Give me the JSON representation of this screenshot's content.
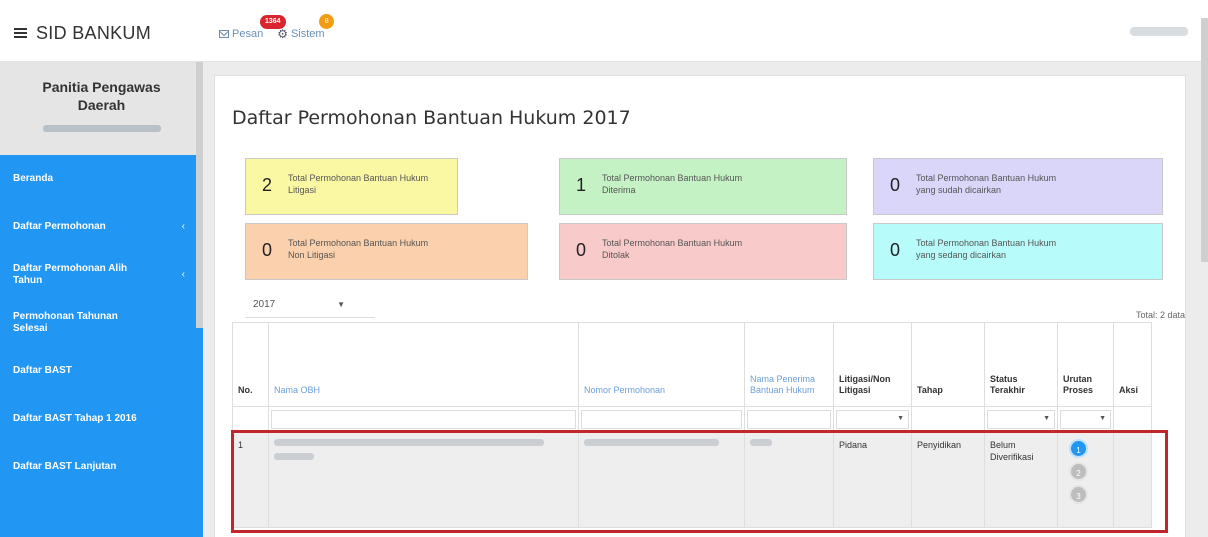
{
  "app": {
    "title": "SID BANKUM"
  },
  "topnav": {
    "pesan_label": "Pesan",
    "pesan_badge": "1364",
    "sistem_label": "Sistem",
    "sistem_badge": "8"
  },
  "sidebar": {
    "org_line1": "Panitia Pengawas",
    "org_line2": "Daerah",
    "items": [
      {
        "label": "Beranda",
        "arrow": ""
      },
      {
        "label": "Daftar Permohonan",
        "arrow": "‹"
      },
      {
        "label": "Daftar Permohonan Alih Tahun",
        "arrow": "‹"
      },
      {
        "label": "Permohonan Tahunan Selesai",
        "arrow": ""
      },
      {
        "label": "Daftar BAST",
        "arrow": ""
      },
      {
        "label": "Daftar BAST Tahap 1 2016",
        "arrow": ""
      },
      {
        "label": "Daftar BAST Lanjutan",
        "arrow": ""
      }
    ]
  },
  "main": {
    "title": "Daftar Permohonan Bantuan Hukum 2017",
    "stats": [
      {
        "value": "2",
        "label": "Total Permohonan Bantuan Hukum Litigasi",
        "color": "#fbf8a4"
      },
      {
        "value": "1",
        "label": "Total Permohonan Bantuan Hukum Diterima",
        "color": "#c5f2c5"
      },
      {
        "value": "0",
        "label": "Total Permohonan Bantuan Hukum yang sudah dicairkan",
        "color": "#d9d6fa"
      },
      {
        "value": "0",
        "label": "Total Permohonan Bantuan Hukum Non Litigasi",
        "color": "#fbd1ad"
      },
      {
        "value": "0",
        "label": "Total Permohonan Bantuan Hukum Ditolak",
        "color": "#f8caca"
      },
      {
        "value": "0",
        "label": "Total Permohonan Bantuan Hukum yang sedang dicairkan",
        "color": "#b8fbfb"
      }
    ],
    "year_select": "2017",
    "total_text": "Total: 2 data"
  },
  "table": {
    "columns": [
      "No.",
      "Nama OBH",
      "Nomor Permohonan",
      "Nama Penerima Bantuan Hukum",
      "Litigasi/Non Litigasi",
      "Tahap",
      "Status Terakhir",
      "Urutan Proses",
      "Aksi"
    ],
    "rows": [
      {
        "no": "1",
        "litigasi": "Pidana",
        "tahap": "Penyidikan",
        "status": "Belum Diverifikasi",
        "steps": [
          "1",
          "2",
          "3"
        ]
      }
    ]
  }
}
